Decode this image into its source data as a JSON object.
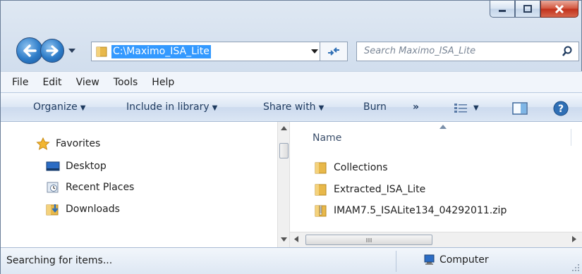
{
  "address": {
    "path": "C:\\Maximo_ISA_Lite",
    "folder_icon": "folder-icon",
    "refresh_icon": "refresh-icon"
  },
  "search": {
    "placeholder": "Search Maximo_ISA_Lite",
    "icon": "search-icon"
  },
  "menu": {
    "items": [
      "File",
      "Edit",
      "View",
      "Tools",
      "Help"
    ]
  },
  "commands": {
    "organize": "Organize",
    "include_in_library": "Include in library",
    "share_with": "Share with",
    "burn": "Burn",
    "more": "»"
  },
  "navigation": {
    "favorites": "Favorites",
    "items": [
      "Desktop",
      "Recent Places",
      "Downloads"
    ]
  },
  "files": {
    "column_name": "Name",
    "items": [
      {
        "name": "Collections",
        "type": "folder"
      },
      {
        "name": "Extracted_ISA_Lite",
        "type": "folder"
      },
      {
        "name": "IMAM7.5_ISALite134_04292011.zip",
        "type": "zip"
      }
    ]
  },
  "status": {
    "text": "Searching for items...",
    "zone": "Computer"
  },
  "colors": {
    "selection": "#3399ff",
    "command_text": "#1e3a5f",
    "folder": "#e8b84a",
    "close_button": "#c0301a"
  }
}
